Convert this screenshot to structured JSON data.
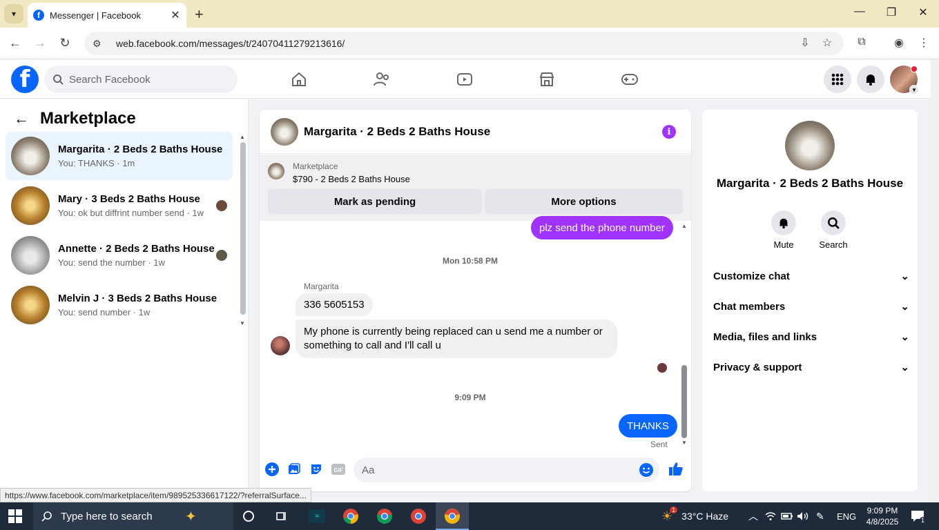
{
  "browser": {
    "tab_title": "Messenger | Facebook",
    "url": "web.facebook.com/messages/t/24070411279213616/",
    "status_url": "https://www.facebook.com/marketplace/item/989525336617122/?referralSurface..."
  },
  "header": {
    "search_placeholder": "Search Facebook"
  },
  "left": {
    "title": "Marketplace",
    "conversations": [
      {
        "name": "Margarita · 2 Beds 2 Baths House",
        "preview": "You: THANKS · 1m"
      },
      {
        "name": "Mary · 3 Beds 2 Baths House",
        "preview": "You: ok but diffrint number send · 1w"
      },
      {
        "name": "Annette · 2 Beds 2 Baths House",
        "preview": "You: send the number · 1w"
      },
      {
        "name": "Melvin J · 3 Beds 2 Baths House",
        "preview": "You: send number · 1w"
      }
    ]
  },
  "chat": {
    "title": "Margarita · 2 Beds 2 Baths House",
    "marketplace_label": "Marketplace",
    "listing": "$790 - 2 Beds 2 Baths House",
    "mark_pending": "Mark as pending",
    "more_options": "More options",
    "messages": {
      "out1": "plz send the phone number",
      "ts1": "Mon 10:58 PM",
      "sender": "Margarita",
      "in1": "336 5605153",
      "in2": "My phone is currently being replaced can u send me a number or something to call and I'll call u",
      "ts2": "9:09 PM",
      "out2": "THANKS",
      "status": "Sent"
    },
    "composer_placeholder": "Aa",
    "accent": "#0866ff",
    "theme_purple": "#a033ff"
  },
  "right": {
    "name": "Margarita · 2 Beds 2 Baths House",
    "mute": "Mute",
    "search": "Search",
    "sections": [
      "Customize chat",
      "Chat members",
      "Media, files and links",
      "Privacy & support"
    ]
  },
  "taskbar": {
    "search_label": "Type here to search",
    "weather": "33°C  Haze",
    "weather_badge": "1",
    "lang": "ENG",
    "time": "9:09 PM",
    "date": "4/8/2025",
    "notif": "1"
  }
}
